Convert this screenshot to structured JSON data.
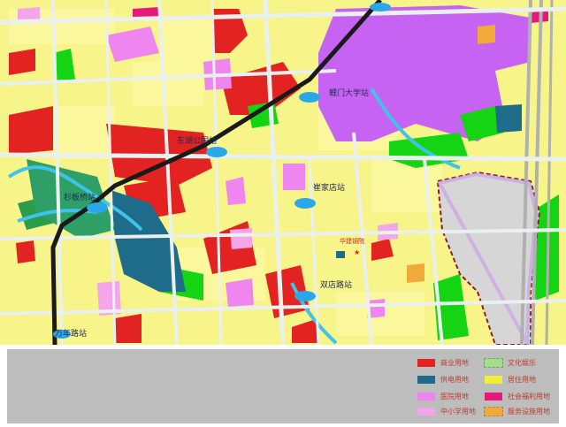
{
  "map": {
    "stations": [
      {
        "name": "鲤门大学站"
      },
      {
        "name": "东湖公园站"
      },
      {
        "name": "杉板桥站"
      },
      {
        "name": "崔家店站"
      },
      {
        "name": "双店路站"
      },
      {
        "name": "万年路站"
      }
    ],
    "site_label": "华建钢院"
  },
  "legend": {
    "items": [
      {
        "label": "商业用地",
        "color": "#e32222",
        "style": "solid"
      },
      {
        "label": "文化娱乐",
        "color": "#a6dd8a",
        "style": "dashed"
      },
      {
        "label": "供电用地",
        "color": "#1e6b8a",
        "style": "solid"
      },
      {
        "label": "居住用地",
        "color": "#f2ef3a",
        "style": "solid"
      },
      {
        "label": "医院用地",
        "color": "#ef86ef",
        "style": "solid"
      },
      {
        "label": "社会福利用地",
        "color": "#e8187a",
        "style": "solid"
      },
      {
        "label": "中小学用地",
        "color": "#f5a6e8",
        "style": "solid"
      },
      {
        "label": "服务设施用地",
        "color": "#f1a93a",
        "style": "dashed"
      }
    ]
  }
}
